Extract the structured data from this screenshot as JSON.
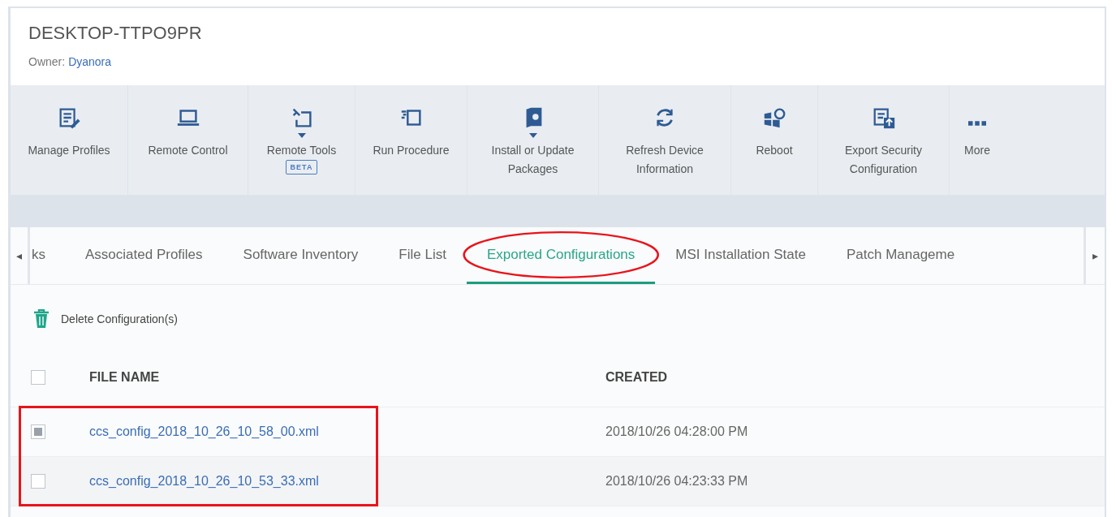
{
  "device": {
    "title": "DESKTOP-TTPO9PR",
    "owner_label": "Owner:",
    "owner": "Dyanora"
  },
  "toolbar": [
    {
      "kind": "profiles",
      "label": "Manage Profiles",
      "dropdown": false
    },
    {
      "kind": "laptop",
      "label": "Remote Control",
      "dropdown": false
    },
    {
      "kind": "tools",
      "label": "Remote Tools",
      "dropdown": true,
      "badge": "BETA"
    },
    {
      "kind": "procedure",
      "label": "Run Procedure",
      "dropdown": false
    },
    {
      "kind": "package",
      "label": "Install or Update Packages",
      "dropdown": true
    },
    {
      "kind": "refresh",
      "label": "Refresh Device Information",
      "dropdown": false
    },
    {
      "kind": "reboot",
      "label": "Reboot",
      "dropdown": false
    },
    {
      "kind": "export",
      "label": "Export Security Configuration",
      "dropdown": false
    },
    {
      "kind": "more",
      "label": "More",
      "dropdown": false
    }
  ],
  "tabs": {
    "scroll_left": "◂",
    "scroll_right": "▸",
    "items": [
      {
        "label": "ks",
        "selected": false,
        "circled": false
      },
      {
        "label": "Associated Profiles",
        "selected": false,
        "circled": false
      },
      {
        "label": "Software Inventory",
        "selected": false,
        "circled": false
      },
      {
        "label": "File List",
        "selected": false,
        "circled": false
      },
      {
        "label": "Exported Configurations",
        "selected": true,
        "circled": true
      },
      {
        "label": "MSI Installation State",
        "selected": false,
        "circled": false
      },
      {
        "label": "Patch Manageme",
        "selected": false,
        "circled": false
      }
    ]
  },
  "actions": [
    {
      "label": "Delete Configuration(s)"
    }
  ],
  "table": {
    "columns": [
      "FILE NAME",
      "CREATED"
    ],
    "all_checked": false,
    "rows_boxed": true,
    "rows": [
      {
        "file_name": "ccs_config_2018_10_26_10_58_00.xml",
        "created": "2018/10/26 04:28:00 PM",
        "checked": true
      },
      {
        "file_name": "ccs_config_2018_10_26_10_53_33.xml",
        "created": "2018/10/26 04:23:33 PM",
        "checked": false
      }
    ]
  }
}
